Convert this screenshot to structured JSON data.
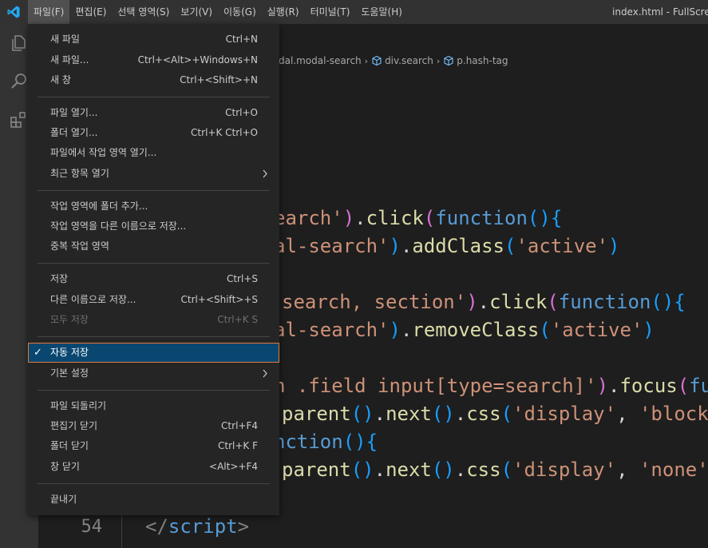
{
  "titlebar": {
    "menus": [
      {
        "label": "파일(F)",
        "active": true
      },
      {
        "label": "편집(E)"
      },
      {
        "label": "선택 영역(S)"
      },
      {
        "label": "보기(V)"
      },
      {
        "label": "이동(G)"
      },
      {
        "label": "실행(R)"
      },
      {
        "label": "터미널(T)"
      },
      {
        "label": "도움말(H)"
      }
    ],
    "window_title": "index.html - FullScreen"
  },
  "activity_icons": [
    "explorer-icon",
    "search-icon",
    "extensions-icon"
  ],
  "breadcrumb": {
    "items": [
      "dal.modal-search",
      "div.search",
      "p.hash-tag"
    ]
  },
  "file_menu": {
    "items": [
      {
        "label": "새 파일",
        "shortcut": "Ctrl+N"
      },
      {
        "label": "새 파일...",
        "shortcut": "Ctrl+<Alt>+Windows+N"
      },
      {
        "label": "새 창",
        "shortcut": "Ctrl+<Shift>+N"
      },
      {
        "label": "파일 열기...",
        "shortcut": "Ctrl+O"
      },
      {
        "label": "폴더 열기...",
        "shortcut": "Ctrl+K Ctrl+O"
      },
      {
        "label": "파일에서 작업 영역 열기...",
        "shortcut": ""
      },
      {
        "label": "최근 항목 열기",
        "shortcut": "",
        "submenu": true
      },
      {
        "label": "작업 영역에 폴더 추가...",
        "shortcut": ""
      },
      {
        "label": "작업 영역을 다른 이름으로 저장...",
        "shortcut": ""
      },
      {
        "label": "중복 작업 영역",
        "shortcut": ""
      },
      {
        "label": "저장",
        "shortcut": "Ctrl+S"
      },
      {
        "label": "다른 이름으로 저장...",
        "shortcut": "Ctrl+<Shift>+S"
      },
      {
        "label": "모두 저장",
        "shortcut": "Ctrl+K S",
        "disabled": true
      },
      {
        "label": "자동 저장",
        "shortcut": "",
        "checked": true,
        "selected": true
      },
      {
        "label": "기본 설정",
        "shortcut": "",
        "submenu": true
      },
      {
        "label": "파일 되돌리기",
        "shortcut": ""
      },
      {
        "label": "편집기 닫기",
        "shortcut": "Ctrl+F4"
      },
      {
        "label": "폴더 닫기",
        "shortcut": "Ctrl+K F"
      },
      {
        "label": "창 닫기",
        "shortcut": "<Alt>+F4"
      },
      {
        "label": "끝내기",
        "shortcut": ""
      }
    ],
    "check_mark": "✓"
  },
  "editor": {
    "line_number": "54",
    "code_lines": [
      [
        [
          "tk-str",
          "earch'"
        ],
        [
          "tk-p2",
          ")"
        ],
        [
          "tk-plain",
          "."
        ],
        [
          "tk-fn",
          "click"
        ],
        [
          "tk-p2",
          "("
        ],
        [
          "tk-kw",
          "function"
        ],
        [
          "tk-p3",
          "()"
        ],
        [
          "tk-p3",
          "{"
        ]
      ],
      [
        [
          "tk-str",
          "al-search'"
        ],
        [
          "tk-p3",
          ")"
        ],
        [
          "tk-plain",
          "."
        ],
        [
          "tk-fn",
          "addClass"
        ],
        [
          "tk-p3",
          "("
        ],
        [
          "tk-str",
          "'active'"
        ],
        [
          "tk-p3",
          ")"
        ]
      ],
      [],
      [
        [
          "tk-str",
          "search, section'"
        ],
        [
          "tk-p2",
          ")"
        ],
        [
          "tk-plain",
          "."
        ],
        [
          "tk-fn",
          "click"
        ],
        [
          "tk-p2",
          "("
        ],
        [
          "tk-kw",
          "function"
        ],
        [
          "tk-p3",
          "()"
        ],
        [
          "tk-p3",
          "{"
        ]
      ],
      [
        [
          "tk-str",
          "al-search'"
        ],
        [
          "tk-p3",
          ")"
        ],
        [
          "tk-plain",
          "."
        ],
        [
          "tk-fn",
          "removeClass"
        ],
        [
          "tk-p3",
          "("
        ],
        [
          "tk-str",
          "'active'"
        ],
        [
          "tk-p3",
          ")"
        ]
      ],
      [],
      [
        [
          "tk-str",
          "n .field input[type=search]'"
        ],
        [
          "tk-p2",
          ")"
        ],
        [
          "tk-plain",
          "."
        ],
        [
          "tk-fn",
          "focus"
        ],
        [
          "tk-p2",
          "("
        ],
        [
          "tk-kw",
          "fun"
        ]
      ],
      [
        [
          "tk-fn",
          "parent"
        ],
        [
          "tk-p3",
          "()"
        ],
        [
          "tk-plain",
          "."
        ],
        [
          "tk-fn",
          "next"
        ],
        [
          "tk-p3",
          "()"
        ],
        [
          "tk-plain",
          "."
        ],
        [
          "tk-fn",
          "css"
        ],
        [
          "tk-p3",
          "("
        ],
        [
          "tk-str",
          "'display'"
        ],
        [
          "tk-plain",
          ", "
        ],
        [
          "tk-str",
          "'block"
        ]
      ],
      [
        [
          "tk-kw",
          "nction"
        ],
        [
          "tk-p3",
          "()"
        ],
        [
          "tk-p3",
          "{"
        ]
      ],
      [
        [
          "tk-fn",
          "parent"
        ],
        [
          "tk-p3",
          "()"
        ],
        [
          "tk-plain",
          "."
        ],
        [
          "tk-fn",
          "next"
        ],
        [
          "tk-p3",
          "()"
        ],
        [
          "tk-plain",
          "."
        ],
        [
          "tk-fn",
          "css"
        ],
        [
          "tk-p3",
          "("
        ],
        [
          "tk-str",
          "'display'"
        ],
        [
          "tk-plain",
          ", "
        ],
        [
          "tk-str",
          "'none'"
        ],
        [
          "tk-p3",
          ")"
        ]
      ],
      [],
      [
        [
          "tk-punc",
          "</"
        ],
        [
          "tk-tag",
          "script"
        ],
        [
          "tk-punc",
          ">"
        ]
      ]
    ]
  }
}
